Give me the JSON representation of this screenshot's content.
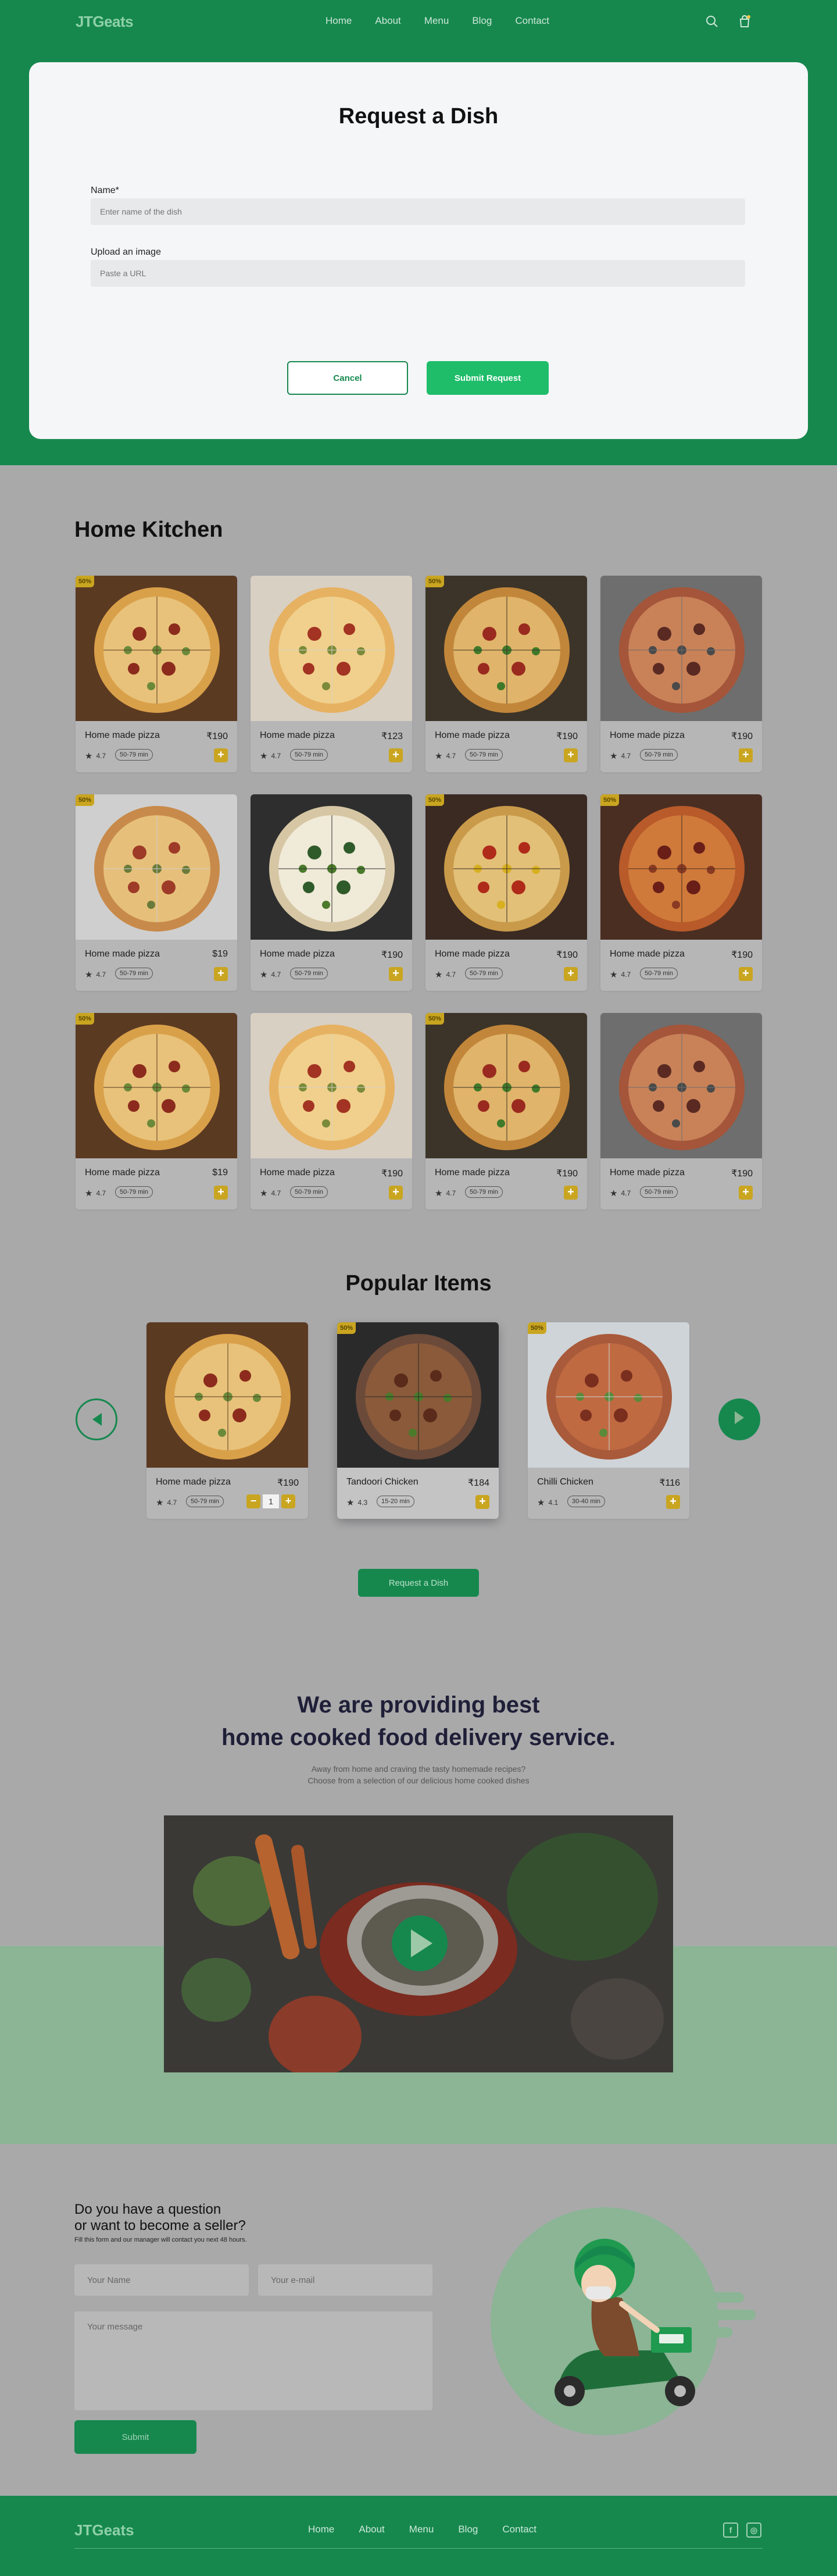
{
  "nav": {
    "logo": "JTGeats",
    "links": [
      "Home",
      "About",
      "Menu",
      "Blog",
      "Contact"
    ],
    "icons": [
      "search-icon",
      "cart-icon"
    ]
  },
  "modal": {
    "title": "Request a Dish",
    "name_label": "Name*",
    "name_placeholder": "Enter name of the dish",
    "image_label": "Upload an image",
    "image_placeholder": "Paste a URL",
    "cancel_label": "Cancel",
    "submit_label": "Submit Request"
  },
  "home_kitchen": {
    "title": "Home Kitchen",
    "items": [
      {
        "name": "Home made pizza",
        "price": "₹190",
        "rating": "4.7",
        "time": "50-79 min",
        "badge": "50%"
      },
      {
        "name": "Home made pizza",
        "price": "₹123",
        "rating": "4.7",
        "time": "50-79 min",
        "badge": ""
      },
      {
        "name": "Home made pizza",
        "price": "₹190",
        "rating": "4.7",
        "time": "50-79 min",
        "badge": "50%"
      },
      {
        "name": "Home made pizza",
        "price": "₹190",
        "rating": "4.7",
        "time": "50-79 min",
        "badge": ""
      },
      {
        "name": "Home made pizza",
        "price": "$19",
        "rating": "4.7",
        "time": "50-79 min",
        "badge": "50%"
      },
      {
        "name": "Home made pizza",
        "price": "₹190",
        "rating": "4.7",
        "time": "50-79 min",
        "badge": ""
      },
      {
        "name": "Home made pizza",
        "price": "₹190",
        "rating": "4.7",
        "time": "50-79 min",
        "badge": "50%"
      },
      {
        "name": "Home made pizza",
        "price": "₹190",
        "rating": "4.7",
        "time": "50-79 min",
        "badge": "50%"
      },
      {
        "name": "Home made pizza",
        "price": "$19",
        "rating": "4.7",
        "time": "50-79 min",
        "badge": "50%"
      },
      {
        "name": "Home made pizza",
        "price": "₹190",
        "rating": "4.7",
        "time": "50-79 min",
        "badge": ""
      },
      {
        "name": "Home made pizza",
        "price": "₹190",
        "rating": "4.7",
        "time": "50-79 min",
        "badge": "50%"
      },
      {
        "name": "Home made pizza",
        "price": "₹190",
        "rating": "4.7",
        "time": "50-79 min",
        "badge": ""
      }
    ]
  },
  "popular": {
    "title": "Popular Items",
    "items": [
      {
        "name": "Home made pizza",
        "price": "₹190",
        "rating": "4.7",
        "time": "50-79 min",
        "badge": "",
        "qty": "1"
      },
      {
        "name": "Tandoori Chicken",
        "price": "₹184",
        "rating": "4.3",
        "time": "15-20 min",
        "badge": "50%"
      },
      {
        "name": "Chilli Chicken",
        "price": "₹116",
        "rating": "4.1",
        "time": "30-40 min",
        "badge": "50%"
      }
    ],
    "request_label": "Request a Dish"
  },
  "providing": {
    "title_line1": "We are providing best",
    "title_line2": "home cooked food delivery service.",
    "sub_line1": "Away from home and craving the tasty homemade recipes?",
    "sub_line2": "Choose from a selection of our delicious home cooked dishes"
  },
  "contact": {
    "title_line1": "Do you have a question",
    "title_line2": "or want to become a seller?",
    "note": "Fill this form and our manager will contact you next 48 hours.",
    "name_placeholder": "Your Name",
    "email_placeholder": "Your e-mail",
    "message_placeholder": "Your message",
    "submit_label": "Submit"
  },
  "footer": {
    "logo": "JTGeats",
    "links": [
      "Home",
      "About",
      "Menu",
      "Blog",
      "Contact"
    ],
    "social_icons": [
      "facebook-icon",
      "instagram-icon"
    ]
  },
  "colors": {
    "brand_green": "#16884e",
    "accent_green": "#1fbd6a",
    "badge_gold": "#c9a520"
  }
}
